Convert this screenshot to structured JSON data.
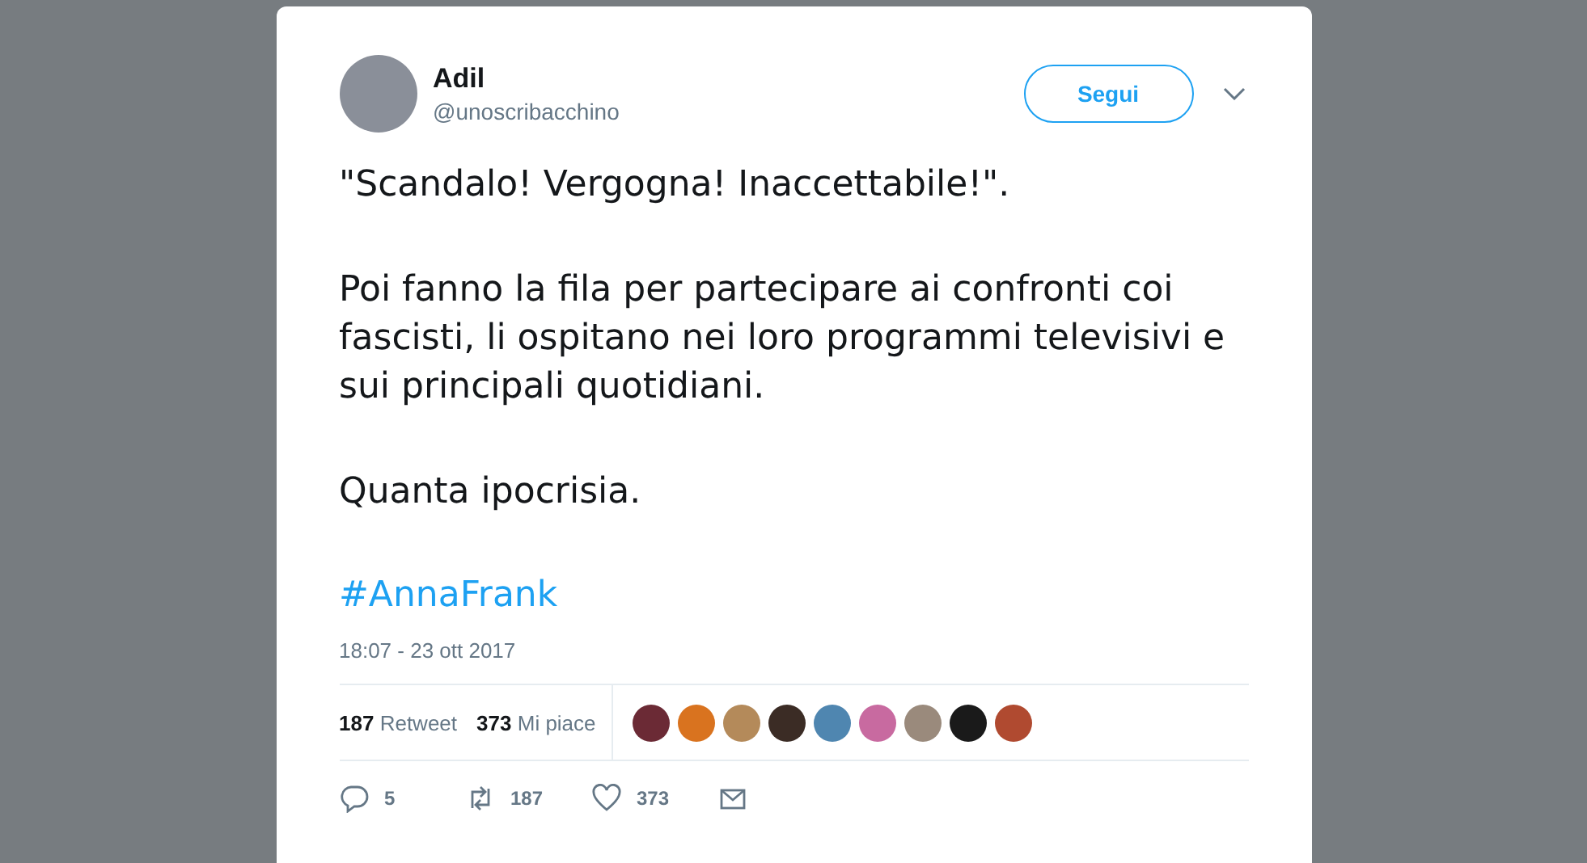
{
  "author": {
    "name": "Adil",
    "handle": "@unoscribacchino"
  },
  "follow_button": "Segui",
  "paragraphs": [
    "\"Scandalo! Vergogna! Inaccettabile!\".",
    "Poi fanno la fila per partecipare ai confronti coi fascisti, li ospitano nei loro programmi televisivi e sui principali quotidiani.",
    "Quanta ipocrisia."
  ],
  "hashtag": "#AnnaFrank",
  "timestamp": "18:07 - 23 ott 2017",
  "stats": [
    {
      "count": "187",
      "label": "Retweet"
    },
    {
      "count": "373",
      "label": "Mi piace"
    }
  ],
  "likers": [
    {
      "color": "#6b2a35"
    },
    {
      "color": "#d9731f"
    },
    {
      "color": "#b48a5a"
    },
    {
      "color": "#3b2c25"
    },
    {
      "color": "#4f86b0"
    },
    {
      "color": "#c86aa0"
    },
    {
      "color": "#9a8a7c"
    },
    {
      "color": "#1a1a1a"
    },
    {
      "color": "#b04a30"
    }
  ],
  "actions": [
    {
      "kind": "reply",
      "count": "5"
    },
    {
      "kind": "retweet",
      "count": "187"
    },
    {
      "kind": "like",
      "count": "373"
    },
    {
      "kind": "message"
    }
  ]
}
